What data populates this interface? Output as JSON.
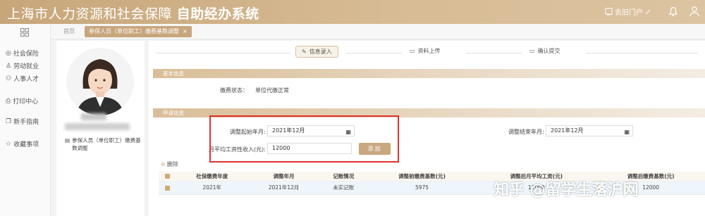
{
  "header": {
    "title_prefix": "上海市人力资源和社会保障",
    "title_bold": "自助经办系统",
    "portal_label": "去旧门户"
  },
  "sidebar": {
    "items": [
      {
        "label": "社会保险",
        "icon": "social-insurance-icon"
      },
      {
        "label": "劳动就业",
        "icon": "employment-icon"
      },
      {
        "label": "人事人才",
        "icon": "talent-icon"
      },
      {
        "label": "打印中心",
        "icon": "printer-icon"
      },
      {
        "label": "新手指南",
        "icon": "guide-icon"
      },
      {
        "label": "收藏事项",
        "icon": "star-icon"
      }
    ]
  },
  "tabs": {
    "home": "首页",
    "active": "参保人员（单位职工）缴费基数调整"
  },
  "profile": {
    "person_type": "参保人员（单位职工）缴费基数调整"
  },
  "steps": [
    "信息录入",
    "资料上传",
    "确认提交"
  ],
  "basic": {
    "section_title": "基本信息",
    "status_label": "缴费状态：",
    "status_value": "单位代缴正常"
  },
  "apply": {
    "section_title": "申请信息",
    "start_label": "调整起始年月:",
    "start_value": "2021年12月",
    "end_label": "调整结束年月:",
    "end_value": "2021年12月",
    "income_label": "月平均工资性收入(元):",
    "income_value": "12000",
    "add_button": "添加"
  },
  "table": {
    "delete_label": "删除",
    "headers": [
      "社保缴费年度",
      "调整年月",
      "记账情况",
      "调整前缴费基数(元)",
      "调整后月平均工资(元)",
      "调整后缴费基数(元)"
    ],
    "rows": [
      [
        "2021年",
        "2021年12月",
        "未实记账",
        "5975",
        "12000",
        "12000"
      ]
    ]
  },
  "watermark": "知乎 @留学生落沪网"
}
